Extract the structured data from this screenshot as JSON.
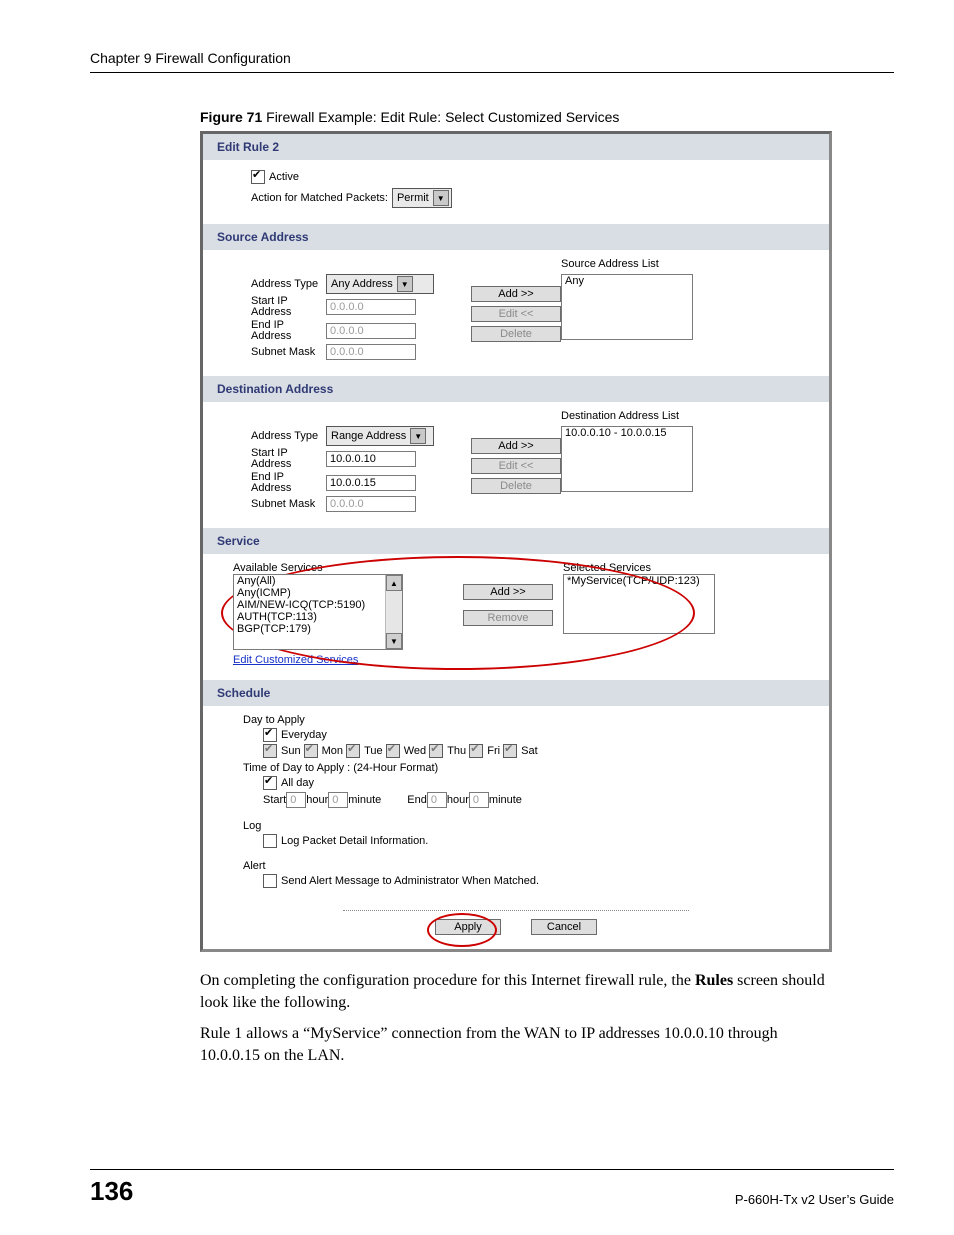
{
  "header": "Chapter 9 Firewall Configuration",
  "caption_bold": "Figure 71",
  "caption_rest": "   Firewall Example: Edit Rule: Select Customized Services",
  "panel": {
    "edit_rule_title": "Edit Rule 2",
    "active_label": "Active",
    "action_label": "Action for Matched Packets:",
    "action_value": "Permit",
    "src": {
      "title": "Source Address",
      "addr_type_label": "Address Type",
      "addr_type_value": "Any Address",
      "start_label": "Start IP Address",
      "start_value": "0.0.0.0",
      "end_label": "End IP Address",
      "end_value": "0.0.0.0",
      "mask_label": "Subnet Mask",
      "mask_value": "0.0.0.0",
      "list_title": "Source Address List",
      "list_item": "Any"
    },
    "dst": {
      "title": "Destination Address",
      "addr_type_label": "Address Type",
      "addr_type_value": "Range Address",
      "start_label": "Start IP Address",
      "start_value": "10.0.0.10",
      "end_label": "End IP Address",
      "end_value": "10.0.0.15",
      "mask_label": "Subnet Mask",
      "mask_value": "0.0.0.0",
      "list_title": "Destination Address List",
      "list_item": "10.0.0.10 - 10.0.0.15"
    },
    "buttons": {
      "add": "Add >>",
      "edit": "Edit <<",
      "delete": "Delete",
      "remove": "Remove",
      "apply": "Apply",
      "cancel": "Cancel"
    },
    "service": {
      "title": "Service",
      "avail_title": "Available Services",
      "avail_items": [
        "Any(All)",
        "Any(ICMP)",
        "AIM/NEW-ICQ(TCP:5190)",
        "AUTH(TCP:113)",
        "BGP(TCP:179)"
      ],
      "sel_title": "Selected Services",
      "sel_item": "*MyService(TCP/UDP:123)",
      "link": "Edit Customized Services"
    },
    "schedule": {
      "title": "Schedule",
      "day_label": "Day to Apply",
      "everyday": "Everyday",
      "days": [
        "Sun",
        "Mon",
        "Tue",
        "Wed",
        "Thu",
        "Fri",
        "Sat"
      ],
      "time_label": "Time of Day to Apply : (24-Hour Format)",
      "allday": "All day",
      "start": "Start",
      "end": "End",
      "hour": "hour",
      "minute": "minute",
      "zero": "0",
      "log_title": "Log",
      "log_label": "Log Packet Detail Information.",
      "alert_title": "Alert",
      "alert_label": "Send Alert Message to Administrator When Matched."
    }
  },
  "para1a": "On completing the configuration procedure for this Internet firewall rule, the ",
  "para1b": "Rules",
  "para1c": " screen should look like the following.",
  "para2": "Rule 1 allows a “MyService” connection from the WAN to IP addresses 10.0.0.10 through 10.0.0.15 on the LAN.",
  "footer": {
    "page": "136",
    "guide": "P-660H-Tx v2 User’s Guide"
  }
}
